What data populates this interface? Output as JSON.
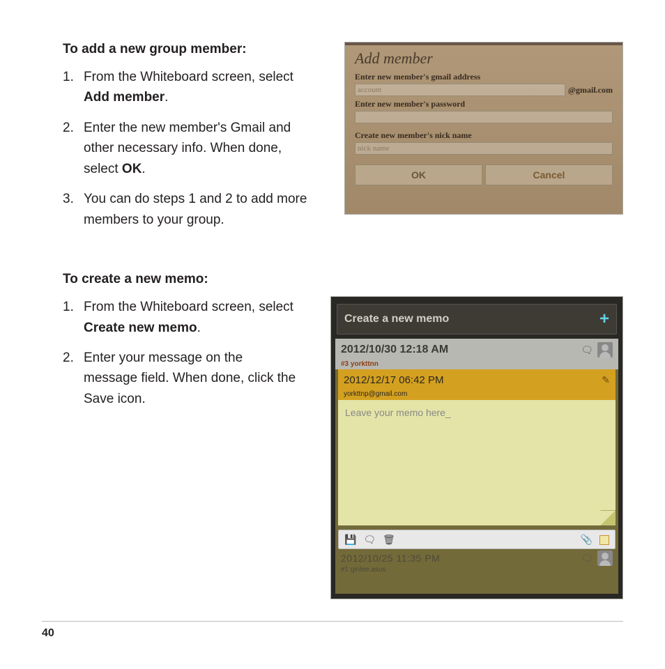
{
  "section1": {
    "heading": "To add a new group member:",
    "steps": [
      {
        "pre": "From the Whiteboard screen, select ",
        "bold": "Add member",
        "post": "."
      },
      {
        "pre": "Enter the new member's Gmail and other necessary info. When done, select ",
        "bold": "OK",
        "post": "."
      },
      {
        "pre": "You can do steps 1 and 2 to add more members to your group.",
        "bold": "",
        "post": ""
      }
    ]
  },
  "shot1": {
    "title": "Add member",
    "label_email": "Enter new member's gmail address",
    "email_placeholder": "account",
    "email_suffix": "@gmail.com",
    "label_pass": "Enter new member's password",
    "label_nick": "Create new member's nick name",
    "nick_placeholder": "nick name",
    "ok": "OK",
    "cancel": "Cancel"
  },
  "section2": {
    "heading": "To create a new memo:",
    "steps": [
      {
        "pre": "From the Whiteboard screen, select ",
        "bold": "Create new memo",
        "post": "."
      },
      {
        "pre": "Enter your message on the message field. When done, click the Save icon.",
        "bold": "",
        "post": ""
      }
    ]
  },
  "shot2": {
    "header": "Create a new memo",
    "plus": "+",
    "row1_time": "2012/10/30 12:18 AM",
    "row1_sub": "#3 yorkttnn",
    "row2_time": "2012/12/17 06:42 PM",
    "row2_sub": "yorkttnp@gmail.com",
    "memo_placeholder": "Leave your memo here_",
    "icons": {
      "save": "💾",
      "reply": "🗨",
      "trash": "🗑",
      "clip": "📎"
    },
    "row3_time": "2012/10/25 11:35 PM",
    "row3_sub": "#1 ginlee.asus"
  },
  "page_number": "40"
}
